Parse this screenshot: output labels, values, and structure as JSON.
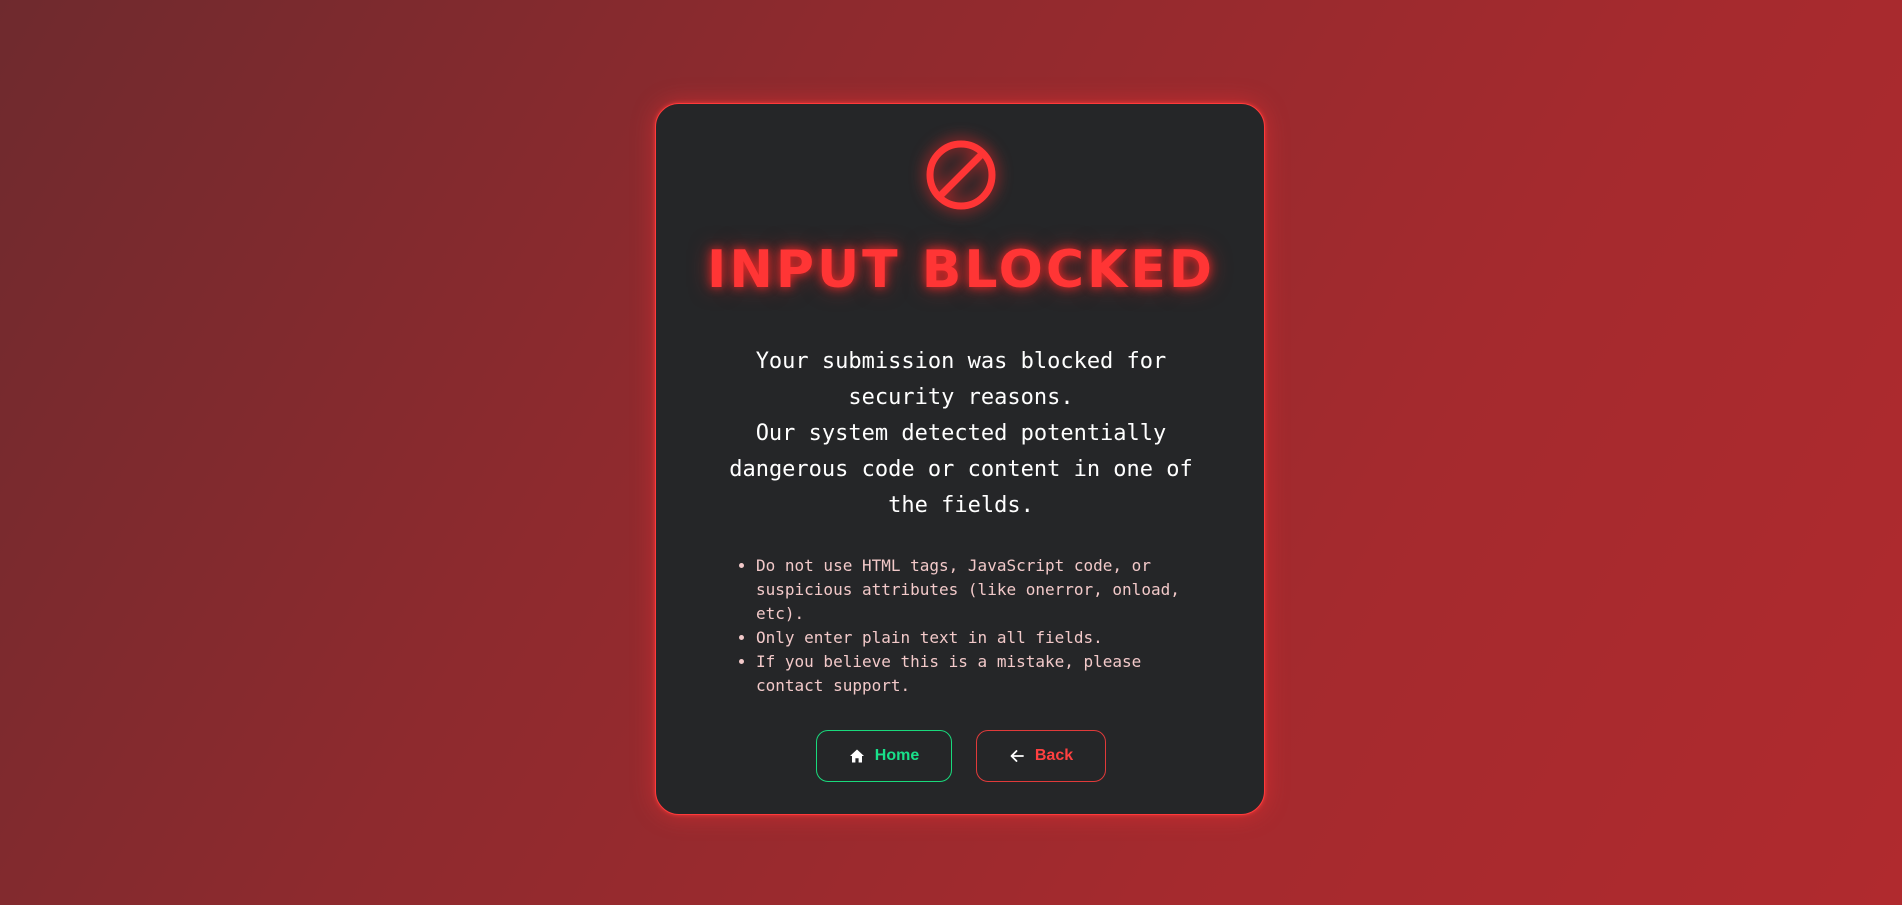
{
  "page": {
    "icon": "block-icon",
    "title": "INPUT BLOCKED",
    "message_lines": [
      "Your submission was blocked for security reasons.",
      "Our system detected potentially dangerous code or content in one of the fields."
    ],
    "tips": [
      "Do not use HTML tags, JavaScript code, or suspicious attributes (like onerror, onload, etc).",
      "Only enter plain text in all fields.",
      "If you believe this is a mistake, please contact support."
    ]
  },
  "buttons": {
    "home": {
      "label": "Home",
      "icon": "home-icon",
      "color": "#19e08a"
    },
    "back": {
      "label": "Back",
      "icon": "arrow-left-icon",
      "color": "#ff4040"
    }
  },
  "colors": {
    "accent": "#ff3535",
    "card_background": "#252628",
    "tips_text": "#f2c9c9"
  }
}
